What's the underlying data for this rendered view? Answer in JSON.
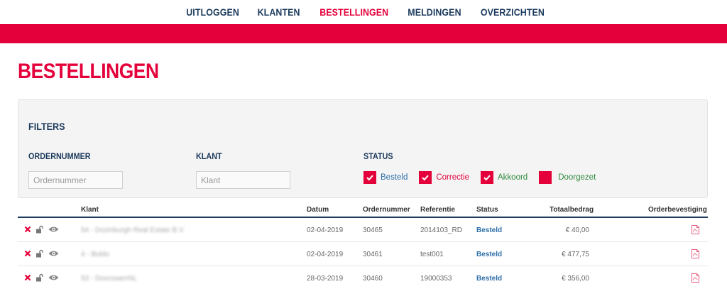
{
  "nav": {
    "items": [
      {
        "label": "UITLOGGEN",
        "active": false
      },
      {
        "label": "KLANTEN",
        "active": false
      },
      {
        "label": "BESTELLINGEN",
        "active": true
      },
      {
        "label": "MELDINGEN",
        "active": false
      },
      {
        "label": "OVERZICHTEN",
        "active": false
      }
    ]
  },
  "colors": {
    "accent": "#e4003a",
    "navy": "#1b3a5c",
    "link": "#2d6ea8",
    "green": "#2e8a3e"
  },
  "page": {
    "title": "BESTELLINGEN"
  },
  "filters": {
    "title": "FILTERS",
    "ordernummer_label": "ORDERNUMMER",
    "ordernummer_placeholder": "Ordernummer",
    "klant_label": "KLANT",
    "klant_placeholder": "Klant",
    "status_label": "STATUS",
    "status_options": [
      {
        "label": "Besteld",
        "checked": true
      },
      {
        "label": "Correctie",
        "checked": true
      },
      {
        "label": "Akkoord",
        "checked": true
      },
      {
        "label": "Doorgezet",
        "checked": false
      }
    ]
  },
  "table": {
    "headers": {
      "klant": "Klant",
      "datum": "Datum",
      "ordernummer": "Ordernummer",
      "referentie": "Referentie",
      "status": "Status",
      "totaalbedrag": "Totaalbedrag",
      "orderbevestiging": "Orderbevestiging"
    },
    "rows": [
      {
        "klant": "54 - Dozinburgh Real Estate B.V.",
        "datum": "02-04-2019",
        "ordernummer": "30465",
        "referentie": "2014103_RD",
        "status": "Besteld",
        "totaalbedrag": "€ 40,00"
      },
      {
        "klant": "4 - Boldo",
        "datum": "02-04-2019",
        "ordernummer": "30461",
        "referentie": "test001",
        "status": "Besteld",
        "totaalbedrag": "€ 477,75"
      },
      {
        "klant": "53 - DoorzaamNL",
        "datum": "28-03-2019",
        "ordernummer": "30460",
        "referentie": "19000353",
        "status": "Besteld",
        "totaalbedrag": "€ 356,00"
      }
    ],
    "row_icons": [
      "close-icon",
      "unlock-icon",
      "eye-icon"
    ],
    "document_icon": "pdf-icon"
  }
}
